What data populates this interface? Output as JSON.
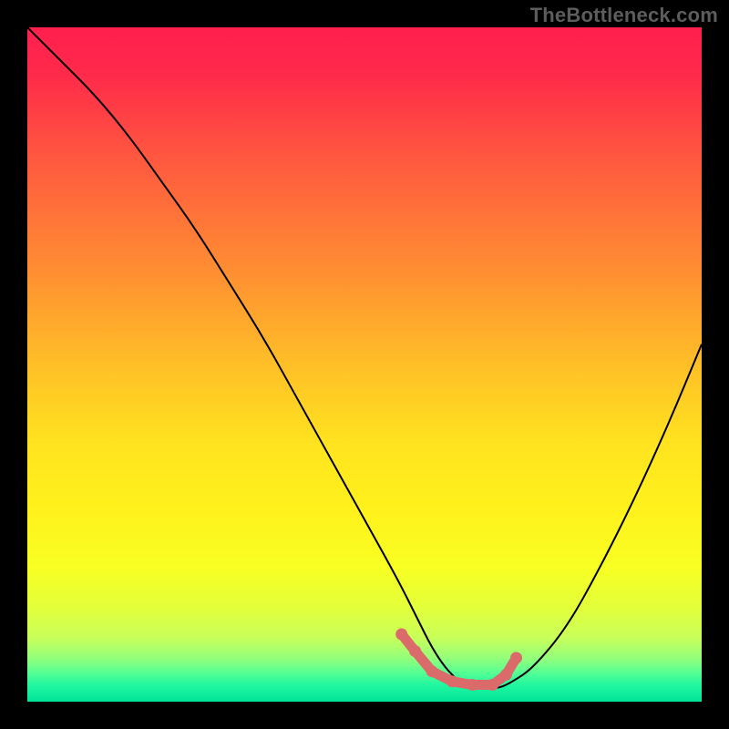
{
  "watermark": "TheBottleneck.com",
  "colors": {
    "gradient_stops": [
      {
        "offset": 0.0,
        "color": "#ff1f4e"
      },
      {
        "offset": 0.07,
        "color": "#ff2a4a"
      },
      {
        "offset": 0.2,
        "color": "#ff5a3f"
      },
      {
        "offset": 0.35,
        "color": "#ff8a33"
      },
      {
        "offset": 0.5,
        "color": "#ffbf27"
      },
      {
        "offset": 0.62,
        "color": "#ffe41f"
      },
      {
        "offset": 0.72,
        "color": "#fff21c"
      },
      {
        "offset": 0.8,
        "color": "#f8ff22"
      },
      {
        "offset": 0.86,
        "color": "#e3ff3a"
      },
      {
        "offset": 0.905,
        "color": "#c8ff5a"
      },
      {
        "offset": 0.935,
        "color": "#95ff7a"
      },
      {
        "offset": 0.955,
        "color": "#5cff92"
      },
      {
        "offset": 0.975,
        "color": "#22f7a0"
      },
      {
        "offset": 1.0,
        "color": "#00e49a"
      }
    ],
    "marker": "#db6b6b",
    "curve": "#000000",
    "background": "#000000"
  },
  "chart_data": {
    "type": "line",
    "title": "",
    "xlabel": "",
    "ylabel": "",
    "xlim": [
      0,
      100
    ],
    "ylim": [
      0,
      100
    ],
    "series": [
      {
        "name": "bottleneck-curve",
        "x": [
          0,
          5,
          10,
          15,
          20,
          25,
          30,
          35,
          40,
          45,
          50,
          55,
          58,
          60,
          62,
          64,
          66,
          68,
          70,
          72,
          75,
          80,
          85,
          90,
          95,
          100
        ],
        "y": [
          100,
          95,
          90,
          84,
          77,
          70,
          62,
          54,
          45,
          36,
          27,
          18,
          12,
          8,
          5,
          3,
          2,
          2,
          2,
          3,
          5,
          11,
          20,
          30,
          41,
          53
        ]
      }
    ],
    "markers": {
      "name": "optimal-range",
      "x": [
        55.5,
        57.5,
        60,
        63,
        66,
        69,
        71,
        72.5
      ],
      "y": [
        10.0,
        7.5,
        4.5,
        3.0,
        2.5,
        2.5,
        4.0,
        6.5
      ]
    }
  }
}
